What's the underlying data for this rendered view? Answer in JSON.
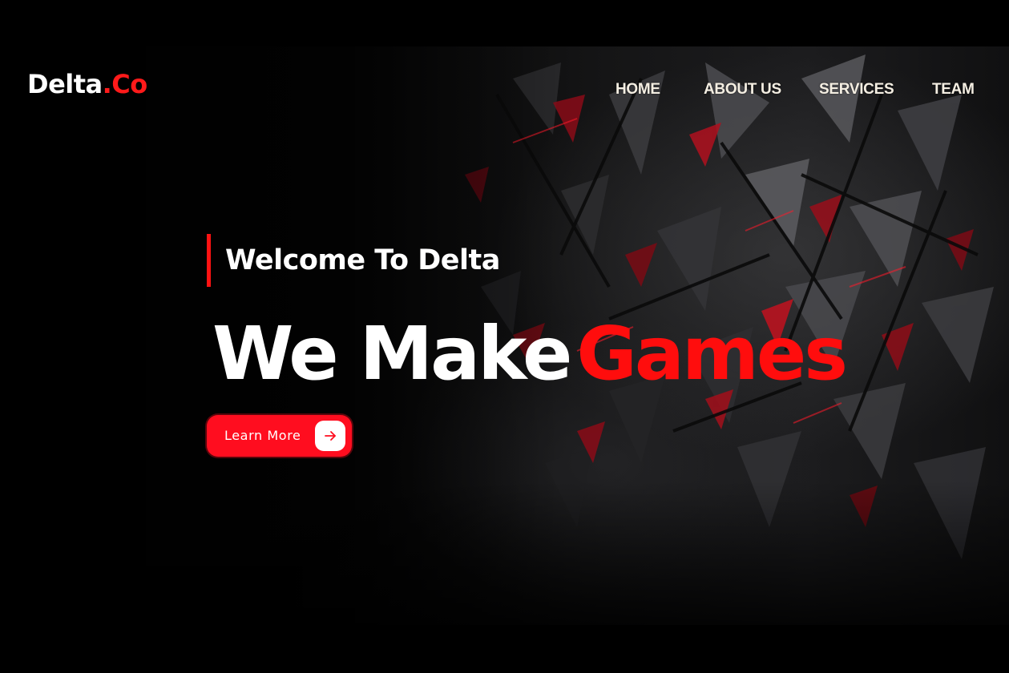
{
  "brand": {
    "name": "Delta",
    "suffix": ".Co"
  },
  "nav": {
    "items": [
      {
        "label": "HOME"
      },
      {
        "label": "ABOUT US"
      },
      {
        "label": "SERVICES"
      },
      {
        "label": "TEAM"
      }
    ]
  },
  "hero": {
    "tagline": "Welcome To Delta",
    "headline_main": "We Make",
    "headline_accent": "Games",
    "cta": {
      "label": "Learn More",
      "icon": "arrow-right-icon"
    }
  },
  "colors": {
    "accent": "#ff0d0d",
    "button": "#ff0d1f",
    "background": "#000000",
    "nav_text": "#f4eee2"
  }
}
